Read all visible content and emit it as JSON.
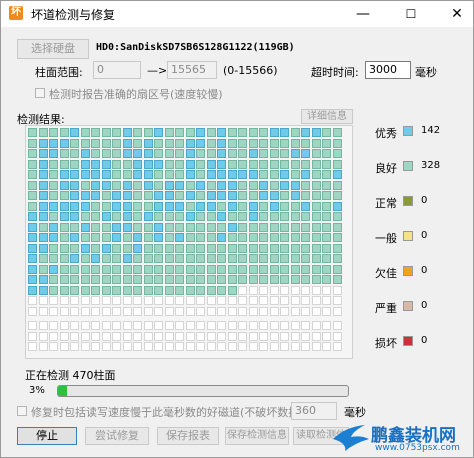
{
  "window": {
    "title": "坏道检测与修复",
    "app_icon": "坏",
    "min": "—",
    "max": "☐",
    "close": "✕"
  },
  "disk": {
    "select_button": "选择硬盘",
    "name": "HD0:SanDiskSD7SB6S128G1122(119GB)"
  },
  "range": {
    "label": "柱面范围:",
    "start": "0",
    "arrow": "—>",
    "end": "15565",
    "hint": "(0-15566)"
  },
  "timeout": {
    "label": "超时时间:",
    "value": "3000",
    "unit": "毫秒"
  },
  "report_option": {
    "label": "检测时报告准确的扇区号(速度较慢)",
    "checked": false
  },
  "results": {
    "label": "检测结果:",
    "details_button": "详细信息"
  },
  "legend": [
    {
      "label": "优秀",
      "color": "#6fcbe8",
      "count": "142"
    },
    {
      "label": "良好",
      "color": "#9ed6c3",
      "count": "328"
    },
    {
      "label": "正常",
      "color": "#8a9a3a",
      "count": "0"
    },
    {
      "label": "一般",
      "color": "#f3e28a",
      "count": "0"
    },
    {
      "label": "欠佳",
      "color": "#f5a020",
      "count": "0"
    },
    {
      "label": "严重",
      "color": "#d8b8a8",
      "count": "0"
    },
    {
      "label": "损坏",
      "color": "#c8323a",
      "count": "0"
    }
  ],
  "grid": {
    "columns": 30,
    "rows": 21,
    "scanned_cells": 470,
    "excellent_cells": [
      4,
      9,
      12,
      16,
      18,
      23,
      24,
      26,
      27,
      31,
      32,
      33,
      39,
      41,
      45,
      46,
      48,
      61,
      62,
      65,
      69,
      70,
      71,
      75,
      78,
      81,
      85,
      86,
      91,
      95,
      96,
      97,
      100,
      101,
      102,
      105,
      107,
      108,
      121,
      123,
      124,
      125,
      126,
      127,
      130,
      131,
      135,
      137,
      138,
      139,
      140,
      141,
      144,
      146,
      149,
      151,
      153,
      154,
      156,
      157,
      159,
      161,
      163,
      164,
      166,
      168,
      169,
      172,
      174,
      175,
      181,
      184,
      185,
      186,
      188,
      189,
      192,
      193,
      195,
      197,
      198,
      199,
      202,
      203,
      205,
      211,
      212,
      213,
      214,
      215,
      218,
      219,
      222,
      223,
      224,
      226,
      227,
      229,
      231,
      233,
      236,
      239,
      240,
      241,
      243,
      244,
      247,
      249,
      251,
      255,
      258,
      261,
      270,
      272,
      275,
      278,
      279,
      282,
      289,
      300,
      301,
      302,
      304,
      308,
      310,
      312,
      314,
      318,
      330,
      331,
      335,
      337,
      340,
      360,
      364,
      366,
      369,
      390,
      392,
      420,
      421,
      450,
      451
    ]
  },
  "status": {
    "text": "正在检测  470柱面",
    "percent_label": "3%",
    "percent": 3
  },
  "repair_option": {
    "label": "修复时包括读写速度慢于此毫秒数的好磁道(不破坏数据):",
    "value": "360",
    "unit": "毫秒",
    "checked": false
  },
  "buttons": {
    "stop": "停止",
    "try_repair": "尝试修复",
    "save_report": "保存报表",
    "save_info": "保存检测信息",
    "read_info": "读取检测信"
  },
  "watermark": {
    "text": "鹏鑫装机网",
    "url": "www.0753psx.com"
  }
}
